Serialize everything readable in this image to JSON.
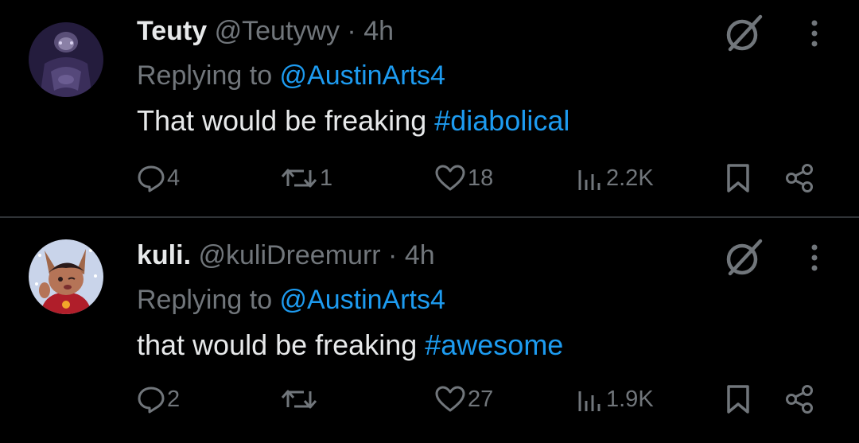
{
  "tweets": [
    {
      "name": "Teuty",
      "handle": "@Teutywy",
      "separator": "·",
      "time": "4h",
      "replying_prefix": "Replying to ",
      "replying_to": "@AustinArts4",
      "text": "That would be freaking ",
      "hashtag": "#diabolical",
      "stats": {
        "replies": "4",
        "retweets": "1",
        "likes": "18",
        "views": "2.2K"
      },
      "avatar_icon": "dark-figure-avatar"
    },
    {
      "name": "kuli.",
      "handle": "@kuliDreemurr",
      "separator": "·",
      "time": "4h",
      "replying_prefix": "Replying to ",
      "replying_to": "@AustinArts4",
      "text": "that would be freaking ",
      "hashtag": "#awesome",
      "stats": {
        "replies": "2",
        "retweets": "",
        "likes": "27",
        "views": "1.9K"
      },
      "avatar_icon": "fox-character-avatar"
    }
  ],
  "colors": {
    "background": "#000000",
    "text_primary": "#e7e9ea",
    "text_secondary": "#71767b",
    "accent": "#1d9bf0",
    "divider": "#2f3336"
  },
  "icons": [
    "reply-icon",
    "retweet-icon",
    "like-icon",
    "views-icon",
    "bookmark-icon",
    "share-icon",
    "not-interested-icon",
    "more-options-icon"
  ]
}
